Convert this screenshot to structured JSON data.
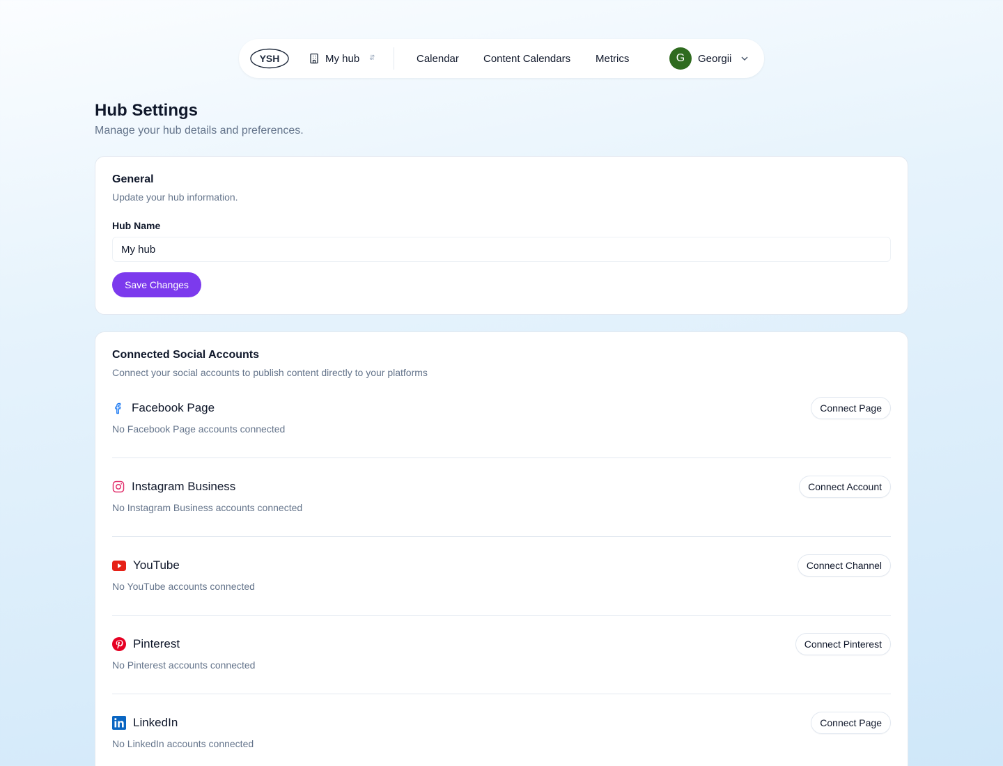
{
  "nav": {
    "logo_text": "YSH",
    "hub_name": "My hub",
    "links": [
      "Calendar",
      "Content Calendars",
      "Metrics"
    ],
    "user": {
      "initial": "G",
      "name": "Georgii"
    }
  },
  "page": {
    "title": "Hub Settings",
    "subtitle": "Manage your hub details and preferences."
  },
  "general": {
    "title": "General",
    "subtitle": "Update your hub information.",
    "hub_name_label": "Hub Name",
    "hub_name_value": "My hub",
    "save_label": "Save Changes"
  },
  "social": {
    "title": "Connected Social Accounts",
    "subtitle": "Connect your social accounts to publish content directly to your platforms",
    "platforms": [
      {
        "name": "Facebook Page",
        "icon": "facebook-icon",
        "status": "No Facebook Page accounts connected",
        "action": "Connect Page"
      },
      {
        "name": "Instagram Business",
        "icon": "instagram-icon",
        "status": "No Instagram Business accounts connected",
        "action": "Connect Account"
      },
      {
        "name": "YouTube",
        "icon": "youtube-icon",
        "status": "No YouTube accounts connected",
        "action": "Connect Channel"
      },
      {
        "name": "Pinterest",
        "icon": "pinterest-icon",
        "status": "No Pinterest accounts connected",
        "action": "Connect Pinterest"
      },
      {
        "name": "LinkedIn",
        "icon": "linkedin-icon",
        "status": "No LinkedIn accounts connected",
        "action": "Connect Page"
      }
    ]
  },
  "colors": {
    "accent": "#7c3aed",
    "avatar": "#2f6b1f",
    "facebook": "#1877f2",
    "instagram": "#e1306c",
    "youtube": "#e62117",
    "pinterest": "#e60023",
    "linkedin": "#0a66c2"
  }
}
